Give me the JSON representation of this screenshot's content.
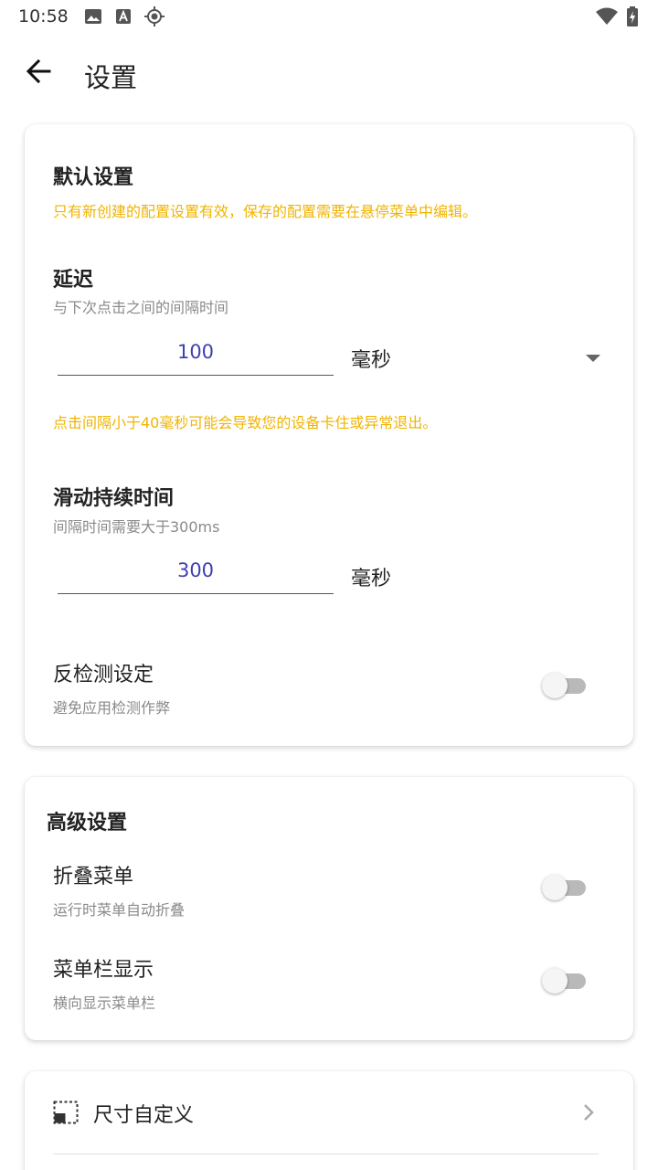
{
  "status_bar": {
    "time": "10:58"
  },
  "app_bar": {
    "title": "设置"
  },
  "default_settings": {
    "title": "默认设置",
    "notice": "只有新创建的配置设置有效，保存的配置需要在悬停菜单中编辑。",
    "delay": {
      "title": "延迟",
      "subtitle": "与下次点击之间的间隔时间",
      "value": "100",
      "unit": "毫秒",
      "warning": "点击间隔小于40毫秒可能会导致您的设备卡住或异常退出。"
    },
    "swipe_duration": {
      "title": "滑动持续时间",
      "subtitle": "间隔时间需要大于300ms",
      "value": "300",
      "unit": "毫秒"
    },
    "anti_detection": {
      "title": "反检测设定",
      "subtitle": "避免应用检测作弊",
      "enabled": false
    }
  },
  "advanced_settings": {
    "title": "高级设置",
    "fold_menu": {
      "title": "折叠菜单",
      "subtitle": "运行时菜单自动折叠",
      "enabled": false
    },
    "menu_bar_display": {
      "title": "菜单栏显示",
      "subtitle": "横向显示菜单栏",
      "enabled": false
    }
  },
  "size_custom": {
    "label": "尺寸自定义",
    "icon": "resize-icon"
  },
  "colors": {
    "warning": "#f0b400",
    "value": "#3f3fb5"
  }
}
